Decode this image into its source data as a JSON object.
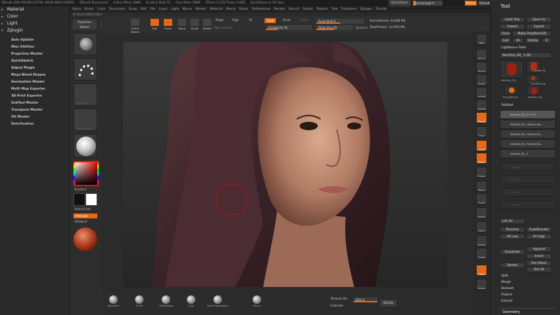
{
  "titlebar": {
    "items": [
      "ZBrush 4R6 P2[3RE3-DT3F-QKXE-SDA3-HXRA]",
      "ZBrush Document",
      "Active Mem 2898",
      "Scratch Disk 51",
      "Free Mem 1999",
      "ZTime 2.278 Timer 0.082",
      "QuickSave In 19 Secs"
    ],
    "quicksave": "QuickSave",
    "seethrough": "See-through 0",
    "menus_btn": "Menus",
    "default_script": "DefaultZScript"
  },
  "menubar": [
    "Alpha",
    "Brush",
    "Color",
    "Document",
    "Draw",
    "Edit",
    "File",
    "Layer",
    "Light",
    "Macro",
    "Marker",
    "Material",
    "Movie",
    "Picker",
    "Preferences",
    "Render",
    "Stencil",
    "Stroke",
    "Texture",
    "Tool",
    "Transform",
    "Zplugin",
    "Zscript"
  ],
  "coords": "-0.454,0.265,0.814",
  "leftpanel": {
    "palettes": [
      {
        "label": "Material",
        "icon": "▸"
      },
      {
        "label": "Color",
        "icon": "▸"
      },
      {
        "label": "Light",
        "icon": "▸"
      },
      {
        "label": "Zplugin",
        "icon": "▾"
      }
    ],
    "plugins": [
      "Auto Update",
      "Misc Utilities",
      "Projection Master",
      "QuickSketch",
      "Adjust Plugin",
      "Maya Blend Shapes",
      "Decimation Master",
      "Multi Map Exporter",
      "3D Print Exporter",
      "SubTool Master",
      "Transpose Master",
      "UV Master",
      "Deactivation"
    ]
  },
  "shelf": {
    "projection_master": "Projection Master",
    "lightbox": "LightBox",
    "gradient": "Gradient",
    "switch_color": "SwitchColor",
    "alternate": "Alternate",
    "fill_object": "FillObject",
    "alpha_off": "Alpha Off",
    "texture_off": "Texture Off"
  },
  "toolbar": {
    "quick_sketch": "Quick Sketch",
    "edit": "Edit",
    "draw": "Draw",
    "move": "Move",
    "scale": "Scale",
    "rotate": "Rotate",
    "mrgb": "Mrgb",
    "rgb": "Rgb",
    "m": "M",
    "rgb_intensity": "Rgb Intensity",
    "zadd": "Zadd",
    "zsub": "Zsub",
    "zcut": "Zcut",
    "z_intensity": "Z Intensity 25",
    "z_intensity_value": 25,
    "focal_shift": "Focal Shift 0",
    "draw_size": "Draw Size 64",
    "draw_size_value": 64,
    "dynamic": "Dynamic",
    "active_points": "ActivePoints: 8.648 Mil",
    "total_points": "TotalPoints: 13.918 Mil"
  },
  "rightshelf": [
    "BPR",
    "SPix 3",
    "Scroll",
    "Zoom",
    "Actual",
    "AAHalf",
    "Persp",
    "Floor",
    "Local",
    "Gxyz",
    "Frame",
    "Move",
    "Scale",
    "Rotate",
    "PolyF",
    "Transp",
    "Ghost",
    "Solo",
    "Xpose"
  ],
  "toolpanel": {
    "title": "Tool",
    "load_tool": "Load Tool",
    "save_as": "Save As",
    "import": "Import",
    "export": "Export",
    "clone": "Clone",
    "make_polymesh": "Make PolyMesh3D",
    "goz": "GoZ",
    "all": "All",
    "visible": "Visible",
    "r": "R",
    "lightbox_tools": "Lightbox ▸ Tools",
    "current_tool": "Norikita_SD_ 1.48",
    "thumbs": [
      "Norikita_SD_",
      "Cylinder3D",
      "PolyMesh3D",
      "SimpleBrush",
      "Norikita_SD_"
    ],
    "subtool_header": "Subtool",
    "subtools": [
      "Norikita_SD_X-1.0.3E",
      "Norikita_SD_ Hamaki_No...",
      "Norikita_SD_ Hamaki_Ro...",
      "Norikita_SD_ 3"
    ],
    "empty_label": "Subtool",
    "list_all": "List All",
    "rename": "Rename",
    "auto_reorder": "AutoReorder",
    "all_low": "All Low",
    "all_high": "All High",
    "duplicate": "Duplicate",
    "append": "Append",
    "insert": "Insert",
    "delete": "Delete",
    "del_other": "Del Other",
    "del_all": "Del All",
    "split": "Split",
    "merge": "Merge",
    "remesh": "Remesh",
    "project": "Project",
    "extract": "Extract",
    "geometry": "Geometry"
  },
  "bottom": {
    "brushes": [
      "Standard",
      "InFlat",
      "ClayBuildup",
      "Clay",
      "Move Topological",
      "Pen A"
    ],
    "texture_on": "Texture On",
    "colorize": "Colorize",
    "sdiv": "SDiv 4",
    "divide": "Divide"
  }
}
